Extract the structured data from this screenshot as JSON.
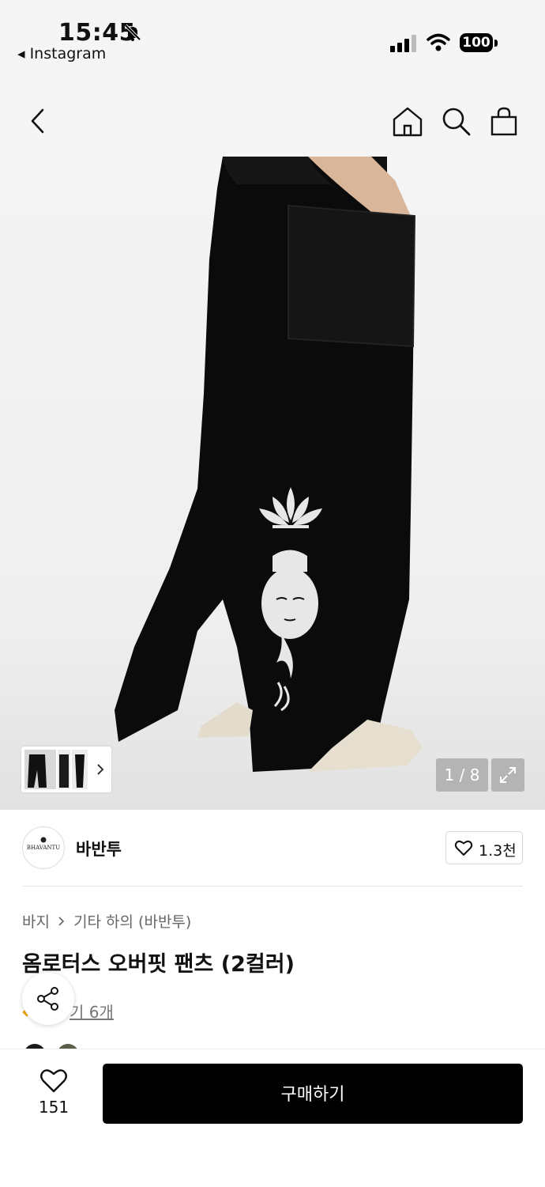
{
  "status_bar": {
    "time": "15:45",
    "back_app_label": "◂ Instagram",
    "battery": "100"
  },
  "gallery": {
    "counter": "1 / 8"
  },
  "brand": {
    "logo_text": "BHAVANTU",
    "name": "바반투",
    "like_count": "1.3천"
  },
  "product": {
    "breadcrumb": [
      "바지",
      "기타 하의 (바반투)"
    ],
    "title": "옴로터스 오버핏 팬츠 (2컬러)",
    "review_label": "기 6개",
    "color_swatches": [
      "#1a1a1a",
      "#5a5f4a"
    ]
  },
  "bottom_bar": {
    "wish_count": "151",
    "buy_label": "구매하기"
  },
  "colors": {
    "accent": "#000000",
    "background": "#f5f5f5"
  }
}
